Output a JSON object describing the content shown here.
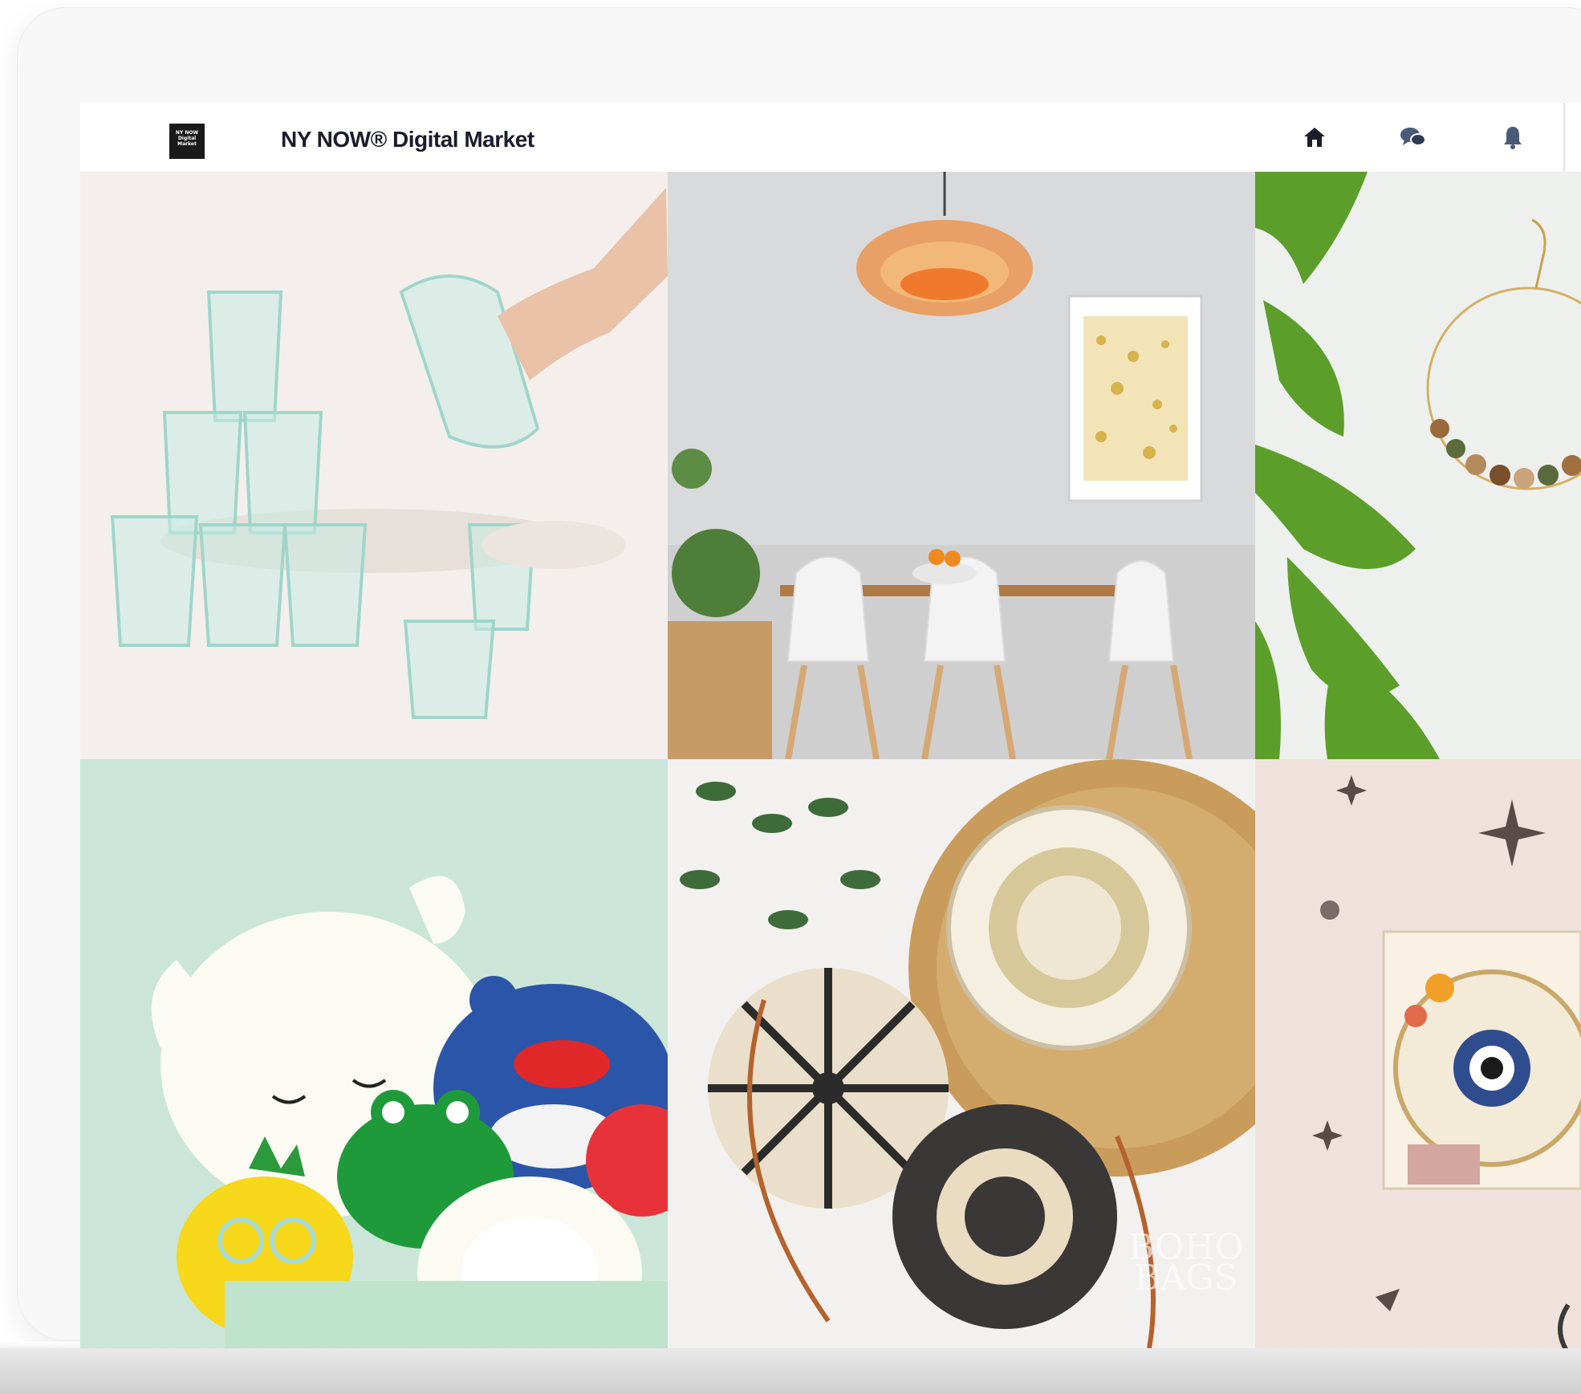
{
  "app": {
    "title": "NY NOW® Digital Market"
  },
  "header": {
    "logo_text": "NY NOW Digital Market",
    "icons": [
      "home-icon",
      "chat-icon",
      "bell-icon"
    ]
  },
  "gallery": {
    "tiles": [
      {
        "subject": "glass-tumblers"
      },
      {
        "subject": "wood-pendant-dining-room"
      },
      {
        "subject": "beaded-hoop-earrings"
      },
      {
        "subject": "plush-toys-box"
      },
      {
        "subject": "round-rattan-bags",
        "watermark": "BOHO BAGS"
      },
      {
        "subject": "embroidery-kit"
      }
    ]
  },
  "colors": {
    "topbar": "#ffffff",
    "title_text": "#1b1b2b",
    "icon": "#2b2b3a",
    "device_frame": "#f7f7f7"
  }
}
